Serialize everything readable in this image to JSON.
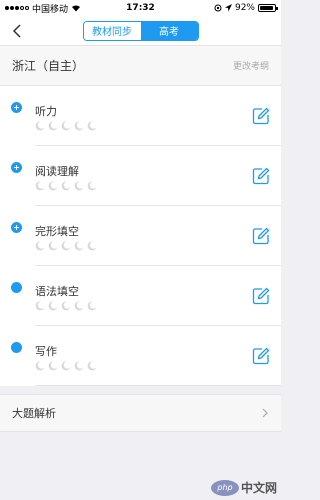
{
  "status_bar": {
    "carrier": "中国移动",
    "time": "17:32",
    "battery": "92%",
    "battery_level": 0.92
  },
  "nav": {
    "segments": [
      "教材同步",
      "高考"
    ],
    "active_segment": "高考"
  },
  "region": {
    "name": "浙江（自主）",
    "change_link": "更改考纲"
  },
  "sections": [
    {
      "title": "听力",
      "icon": "plus-circle-icon",
      "moons": 5
    },
    {
      "title": "阅读理解",
      "icon": "plus-circle-icon",
      "moons": 5
    },
    {
      "title": "完形填空",
      "icon": "plus-circle-icon",
      "moons": 5
    },
    {
      "title": "语法填空",
      "icon": "dot-icon",
      "moons": 5
    },
    {
      "title": "写作",
      "icon": "dot-icon",
      "moons": 5
    }
  ],
  "analysis": {
    "label": "大题解析"
  },
  "watermark": {
    "logo": "php",
    "text": "中文网"
  },
  "colors": {
    "accent": "#1e9bf0",
    "background": "#efeff4",
    "moon": "#d9d9d9"
  }
}
